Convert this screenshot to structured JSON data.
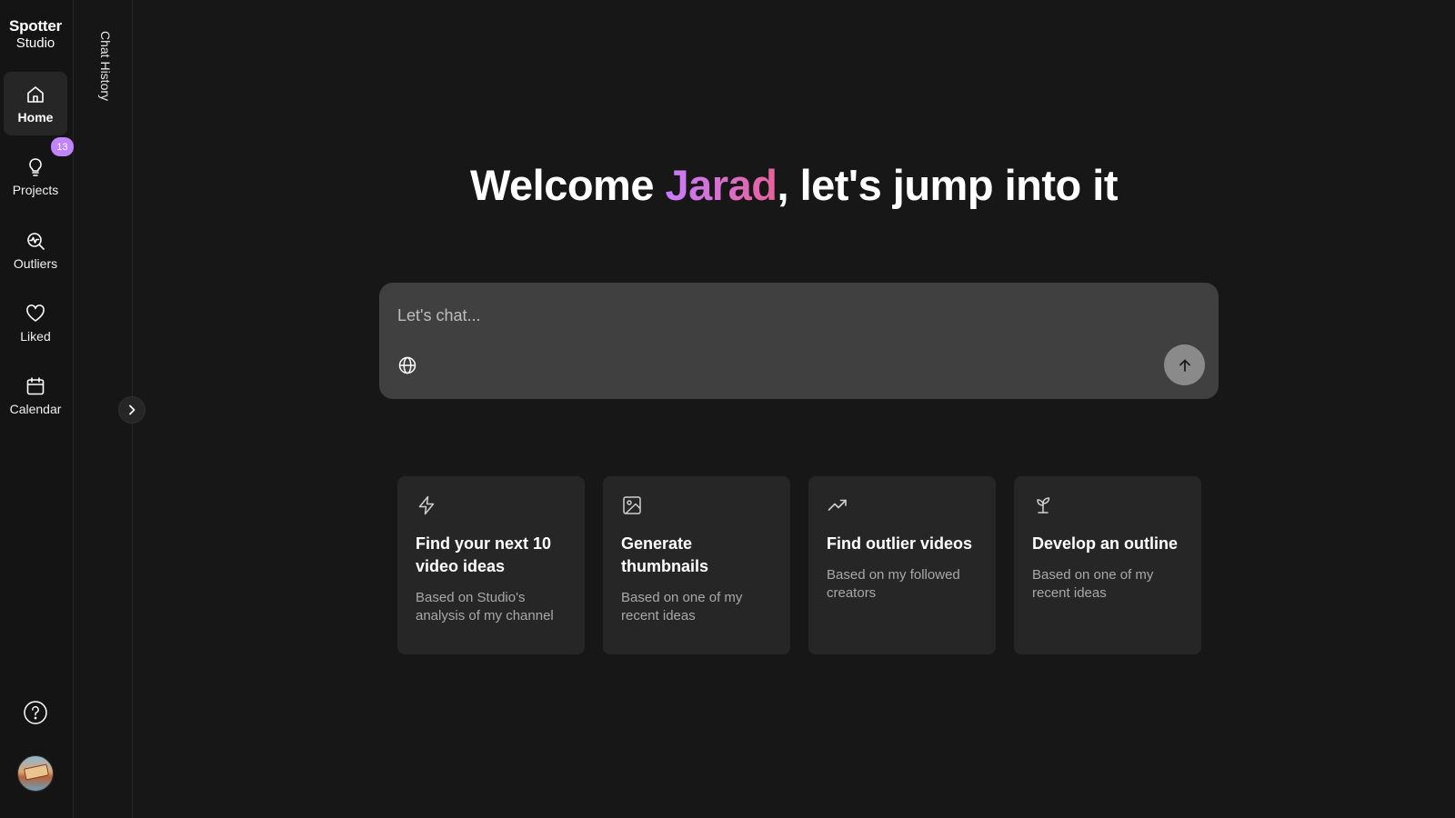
{
  "brand": {
    "line1": "Spotter",
    "line2": "Studio"
  },
  "nav": {
    "items": [
      {
        "label": "Home",
        "icon": "home-icon",
        "active": true
      },
      {
        "label": "Projects",
        "icon": "lightbulb-icon",
        "badge": "13"
      },
      {
        "label": "Outliers",
        "icon": "outliers-icon"
      },
      {
        "label": "Liked",
        "icon": "heart-icon"
      },
      {
        "label": "Calendar",
        "icon": "calendar-icon"
      }
    ],
    "help_icon": "help-icon",
    "avatar": "user-avatar"
  },
  "history": {
    "label": "Chat History"
  },
  "welcome": {
    "prefix": "Welcome ",
    "name": "Jarad",
    "suffix": ", let's jump into it"
  },
  "chat": {
    "placeholder": "Let's chat...",
    "value": ""
  },
  "cards": [
    {
      "icon": "lightning-icon",
      "title": "Find your next 10 video ideas",
      "subtitle": "Based on Studio's analysis of my channel"
    },
    {
      "icon": "image-icon",
      "title": "Generate thumbnails",
      "subtitle": "Based on one of my recent ideas"
    },
    {
      "icon": "trending-up-icon",
      "title": "Find outlier videos",
      "subtitle": "Based on my followed creators"
    },
    {
      "icon": "sprout-icon",
      "title": "Develop an outline",
      "subtitle": "Based on one of my recent ideas"
    }
  ],
  "colors": {
    "accent": "#c084fc",
    "name_gradient_start": "#c77dff",
    "name_gradient_end": "#e8619a"
  }
}
